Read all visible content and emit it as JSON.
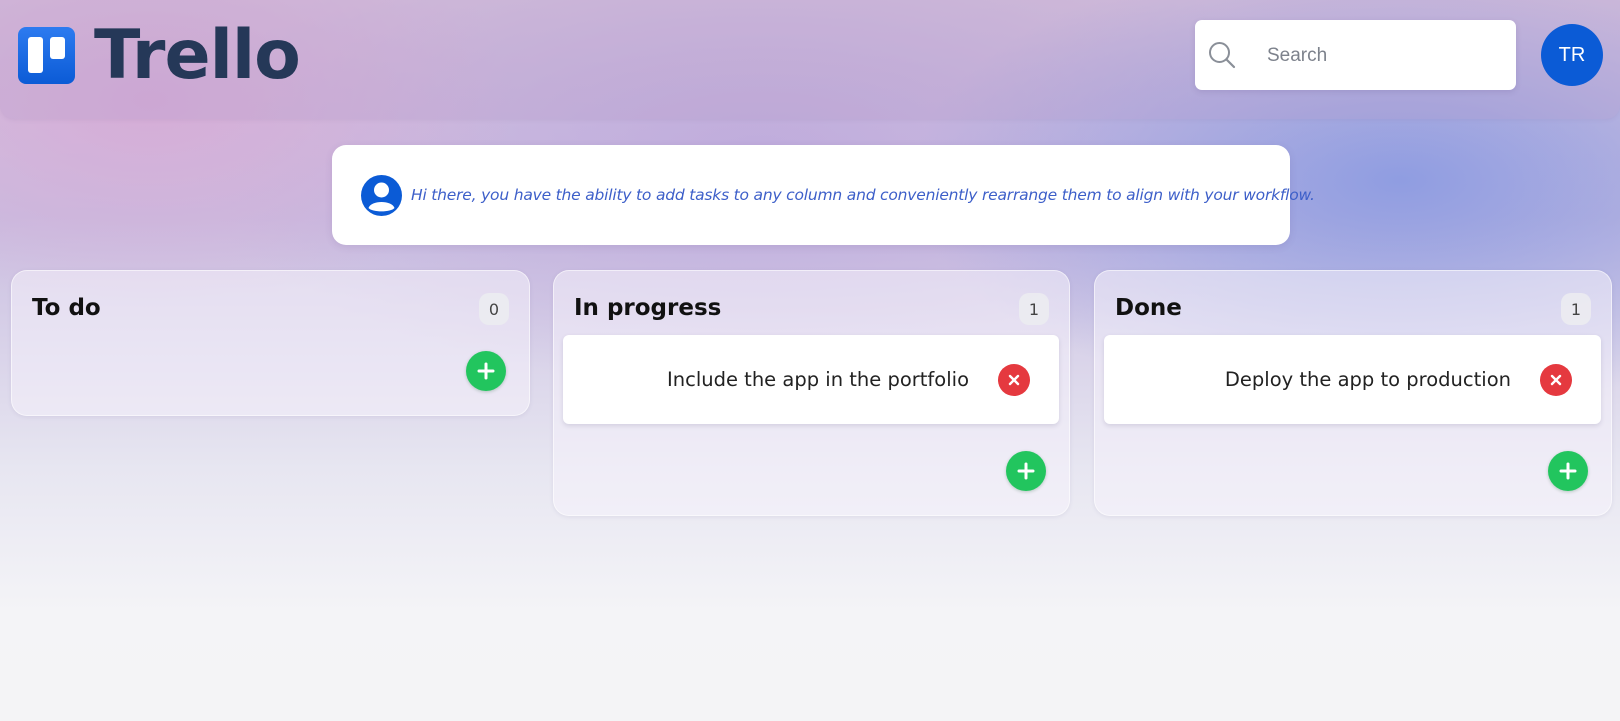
{
  "header": {
    "logo_text": "Trello",
    "logo_icon": "trello-board-icon",
    "search": {
      "placeholder": "Search",
      "value": "",
      "icon": "search-icon"
    },
    "avatar_initials": "TR"
  },
  "notice": {
    "icon": "user-circle-icon",
    "text": "Hi there, you have the ability to add tasks to any column and conveniently rearrange them to align with your workflow."
  },
  "columns": [
    {
      "title": "To do",
      "count": "0",
      "tasks": [],
      "add_icon": "plus-icon"
    },
    {
      "title": "In progress",
      "count": "1",
      "tasks": [
        {
          "text": "Include the app in the portfolio",
          "delete_icon": "close-icon"
        }
      ],
      "add_icon": "plus-icon"
    },
    {
      "title": "Done",
      "count": "1",
      "tasks": [
        {
          "text": "Deploy the app to production",
          "delete_icon": "close-icon"
        }
      ],
      "add_icon": "plus-icon"
    }
  ],
  "colors": {
    "brand_blue": "#0b5bd6",
    "logo_text": "#253858",
    "add_green": "#22c55e",
    "delete_red": "#e5393f",
    "notice_text": "#3d5fc9"
  }
}
